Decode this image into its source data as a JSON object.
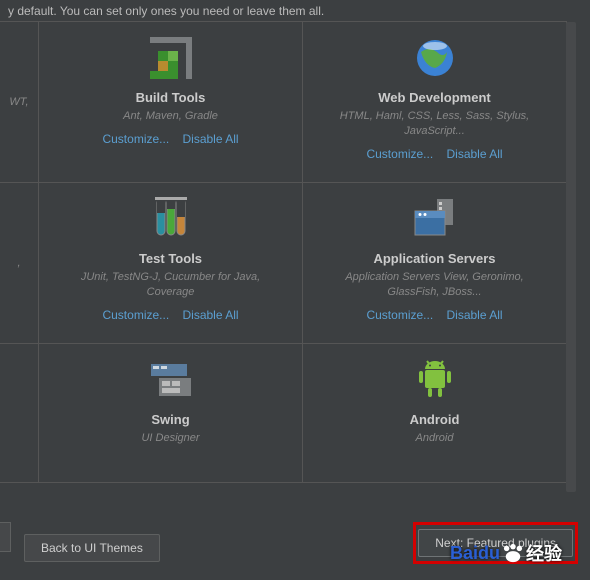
{
  "top_text": "y default. You can set only ones you need or leave them all.",
  "left_fragments": [
    "WT,",
    ","
  ],
  "cards": [
    {
      "title": "Build Tools",
      "desc": "Ant, Maven, Gradle",
      "customize": "Customize...",
      "disable": "Disable All"
    },
    {
      "title": "Web Development",
      "desc": "HTML, Haml, CSS, Less, Sass, Stylus, JavaScript...",
      "customize": "Customize...",
      "disable": "Disable All"
    },
    {
      "title": "Test Tools",
      "desc": "JUnit, TestNG-J, Cucumber for Java, Coverage",
      "customize": "Customize...",
      "disable": "Disable All"
    },
    {
      "title": "Application Servers",
      "desc": "Application Servers View, Geronimo, GlassFish, JBoss...",
      "customize": "Customize...",
      "disable": "Disable All"
    },
    {
      "title": "Swing",
      "desc": "UI Designer"
    },
    {
      "title": "Android",
      "desc": "Android"
    }
  ],
  "footer": {
    "back": "Back to UI Themes",
    "next": "Next: Featured plugins"
  },
  "watermark": {
    "brand": "Baidu",
    "suffix": "经验"
  }
}
